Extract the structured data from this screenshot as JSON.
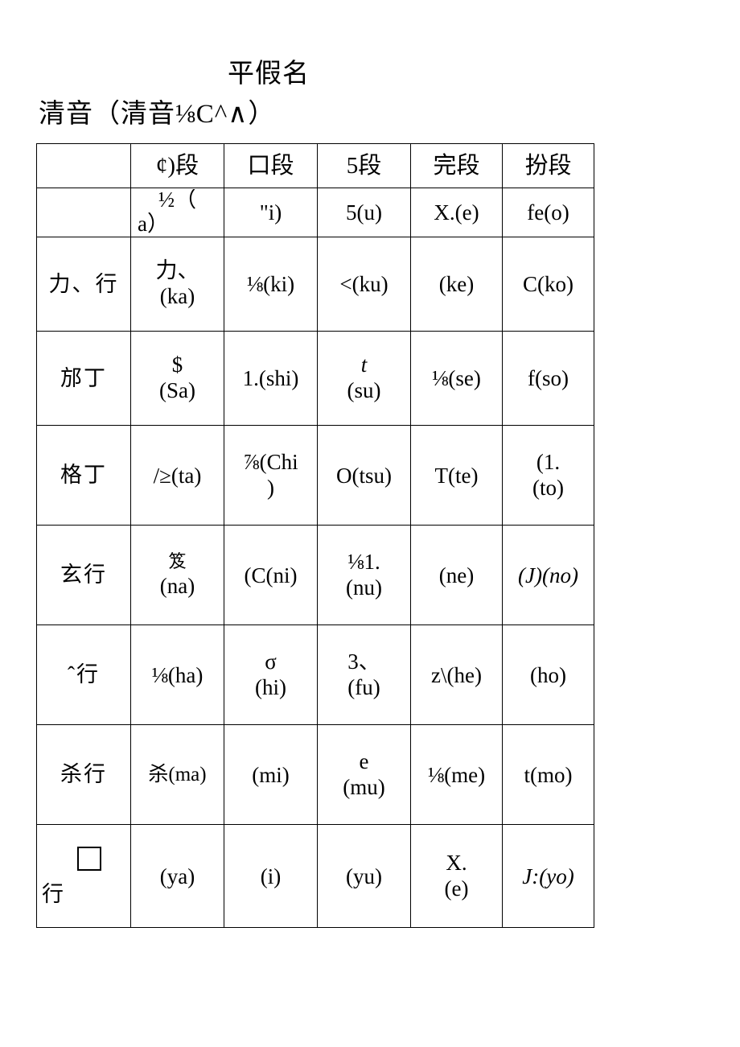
{
  "document": {
    "title": "平假名",
    "subtitle": "清音（清音⅛C^∧）"
  },
  "table": {
    "header": [
      "",
      "¢)段",
      "口段",
      "5段",
      "完段",
      "扮段"
    ],
    "rows": [
      {
        "label": "",
        "cells": [
          {
            "kana": "½（",
            "kana2": "a）",
            "romaji": "",
            "clipped": true
          },
          {
            "kana": "",
            "romaji": "\"i)"
          },
          {
            "kana": "",
            "romaji": "5(u)"
          },
          {
            "kana": "",
            "romaji": "X.(e)"
          },
          {
            "kana": "",
            "romaji": "fe(o)"
          }
        ]
      },
      {
        "label": "力、行",
        "cells": [
          {
            "kana": "力、",
            "romaji": "(ka)"
          },
          {
            "kana": "",
            "romaji": "⅛(ki)"
          },
          {
            "kana": "",
            "romaji": "<(ku)"
          },
          {
            "kana": "",
            "romaji": "(ke)"
          },
          {
            "kana": "",
            "romaji": "C(ko)"
          }
        ]
      },
      {
        "label": "邡丁",
        "cells": [
          {
            "kana": "$",
            "romaji": "(Sa)"
          },
          {
            "kana": "",
            "romaji": "1.(shi)"
          },
          {
            "kana": "t",
            "romaji": "(su)"
          },
          {
            "kana": "",
            "romaji": "⅛(se)"
          },
          {
            "kana": "",
            "romaji": "f(so)"
          }
        ]
      },
      {
        "label": "格丁",
        "cells": [
          {
            "kana": "",
            "romaji": "/≥(ta)"
          },
          {
            "kana": "⅞(Chi",
            "romaji": ")"
          },
          {
            "kana": "",
            "romaji": "O(tsu)"
          },
          {
            "kana": "",
            "romaji": "T(te)"
          },
          {
            "kana": "(1.",
            "romaji": "(to)"
          }
        ]
      },
      {
        "label": "玄行",
        "cells": [
          {
            "kana": "笈",
            "romaji": "(na)"
          },
          {
            "kana": "",
            "romaji": "(C(ni)"
          },
          {
            "kana": "⅛1.",
            "romaji": "(nu)"
          },
          {
            "kana": "",
            "romaji": "(ne)"
          },
          {
            "kana": "",
            "romaji": "(J)(no)"
          }
        ]
      },
      {
        "label": "ˆ行",
        "cells": [
          {
            "kana": "",
            "romaji": "⅛(ha)"
          },
          {
            "kana": "σ",
            "romaji": "(hi)"
          },
          {
            "kana": "3、",
            "romaji": "(fu)"
          },
          {
            "kana": "",
            "romaji": "z\\(he)"
          },
          {
            "kana": "",
            "romaji": "(ho)"
          }
        ]
      },
      {
        "label": "杀行",
        "cells": [
          {
            "kana": "",
            "romaji": "杀(ma)"
          },
          {
            "kana": "",
            "romaji": "(mi)"
          },
          {
            "kana": "e",
            "romaji": "(mu)"
          },
          {
            "kana": "",
            "romaji": "⅛(me)"
          },
          {
            "kana": "",
            "romaji": "t(mo)"
          }
        ]
      },
      {
        "label": "□行",
        "label_box": "□",
        "label_tail": "行",
        "cells": [
          {
            "kana": "",
            "romaji": "(ya)"
          },
          {
            "kana": "",
            "romaji": "(i)"
          },
          {
            "kana": "",
            "romaji": "(yu)"
          },
          {
            "kana": "X.",
            "romaji": "(e)"
          },
          {
            "kana": "",
            "romaji": "J:(yo)"
          }
        ]
      }
    ]
  }
}
